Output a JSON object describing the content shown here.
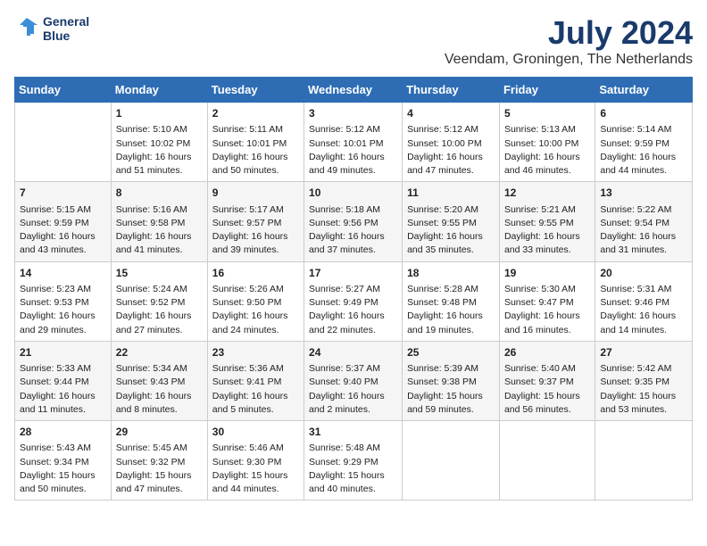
{
  "header": {
    "logo_line1": "General",
    "logo_line2": "Blue",
    "month_title": "July 2024",
    "location": "Veendam, Groningen, The Netherlands"
  },
  "calendar": {
    "days_of_week": [
      "Sunday",
      "Monday",
      "Tuesday",
      "Wednesday",
      "Thursday",
      "Friday",
      "Saturday"
    ],
    "weeks": [
      [
        {
          "day": "",
          "content": ""
        },
        {
          "day": "1",
          "content": "Sunrise: 5:10 AM\nSunset: 10:02 PM\nDaylight: 16 hours\nand 51 minutes."
        },
        {
          "day": "2",
          "content": "Sunrise: 5:11 AM\nSunset: 10:01 PM\nDaylight: 16 hours\nand 50 minutes."
        },
        {
          "day": "3",
          "content": "Sunrise: 5:12 AM\nSunset: 10:01 PM\nDaylight: 16 hours\nand 49 minutes."
        },
        {
          "day": "4",
          "content": "Sunrise: 5:12 AM\nSunset: 10:00 PM\nDaylight: 16 hours\nand 47 minutes."
        },
        {
          "day": "5",
          "content": "Sunrise: 5:13 AM\nSunset: 10:00 PM\nDaylight: 16 hours\nand 46 minutes."
        },
        {
          "day": "6",
          "content": "Sunrise: 5:14 AM\nSunset: 9:59 PM\nDaylight: 16 hours\nand 44 minutes."
        }
      ],
      [
        {
          "day": "7",
          "content": "Sunrise: 5:15 AM\nSunset: 9:59 PM\nDaylight: 16 hours\nand 43 minutes."
        },
        {
          "day": "8",
          "content": "Sunrise: 5:16 AM\nSunset: 9:58 PM\nDaylight: 16 hours\nand 41 minutes."
        },
        {
          "day": "9",
          "content": "Sunrise: 5:17 AM\nSunset: 9:57 PM\nDaylight: 16 hours\nand 39 minutes."
        },
        {
          "day": "10",
          "content": "Sunrise: 5:18 AM\nSunset: 9:56 PM\nDaylight: 16 hours\nand 37 minutes."
        },
        {
          "day": "11",
          "content": "Sunrise: 5:20 AM\nSunset: 9:55 PM\nDaylight: 16 hours\nand 35 minutes."
        },
        {
          "day": "12",
          "content": "Sunrise: 5:21 AM\nSunset: 9:55 PM\nDaylight: 16 hours\nand 33 minutes."
        },
        {
          "day": "13",
          "content": "Sunrise: 5:22 AM\nSunset: 9:54 PM\nDaylight: 16 hours\nand 31 minutes."
        }
      ],
      [
        {
          "day": "14",
          "content": "Sunrise: 5:23 AM\nSunset: 9:53 PM\nDaylight: 16 hours\nand 29 minutes."
        },
        {
          "day": "15",
          "content": "Sunrise: 5:24 AM\nSunset: 9:52 PM\nDaylight: 16 hours\nand 27 minutes."
        },
        {
          "day": "16",
          "content": "Sunrise: 5:26 AM\nSunset: 9:50 PM\nDaylight: 16 hours\nand 24 minutes."
        },
        {
          "day": "17",
          "content": "Sunrise: 5:27 AM\nSunset: 9:49 PM\nDaylight: 16 hours\nand 22 minutes."
        },
        {
          "day": "18",
          "content": "Sunrise: 5:28 AM\nSunset: 9:48 PM\nDaylight: 16 hours\nand 19 minutes."
        },
        {
          "day": "19",
          "content": "Sunrise: 5:30 AM\nSunset: 9:47 PM\nDaylight: 16 hours\nand 16 minutes."
        },
        {
          "day": "20",
          "content": "Sunrise: 5:31 AM\nSunset: 9:46 PM\nDaylight: 16 hours\nand 14 minutes."
        }
      ],
      [
        {
          "day": "21",
          "content": "Sunrise: 5:33 AM\nSunset: 9:44 PM\nDaylight: 16 hours\nand 11 minutes."
        },
        {
          "day": "22",
          "content": "Sunrise: 5:34 AM\nSunset: 9:43 PM\nDaylight: 16 hours\nand 8 minutes."
        },
        {
          "day": "23",
          "content": "Sunrise: 5:36 AM\nSunset: 9:41 PM\nDaylight: 16 hours\nand 5 minutes."
        },
        {
          "day": "24",
          "content": "Sunrise: 5:37 AM\nSunset: 9:40 PM\nDaylight: 16 hours\nand 2 minutes."
        },
        {
          "day": "25",
          "content": "Sunrise: 5:39 AM\nSunset: 9:38 PM\nDaylight: 15 hours\nand 59 minutes."
        },
        {
          "day": "26",
          "content": "Sunrise: 5:40 AM\nSunset: 9:37 PM\nDaylight: 15 hours\nand 56 minutes."
        },
        {
          "day": "27",
          "content": "Sunrise: 5:42 AM\nSunset: 9:35 PM\nDaylight: 15 hours\nand 53 minutes."
        }
      ],
      [
        {
          "day": "28",
          "content": "Sunrise: 5:43 AM\nSunset: 9:34 PM\nDaylight: 15 hours\nand 50 minutes."
        },
        {
          "day": "29",
          "content": "Sunrise: 5:45 AM\nSunset: 9:32 PM\nDaylight: 15 hours\nand 47 minutes."
        },
        {
          "day": "30",
          "content": "Sunrise: 5:46 AM\nSunset: 9:30 PM\nDaylight: 15 hours\nand 44 minutes."
        },
        {
          "day": "31",
          "content": "Sunrise: 5:48 AM\nSunset: 9:29 PM\nDaylight: 15 hours\nand 40 minutes."
        },
        {
          "day": "",
          "content": ""
        },
        {
          "day": "",
          "content": ""
        },
        {
          "day": "",
          "content": ""
        }
      ]
    ]
  }
}
